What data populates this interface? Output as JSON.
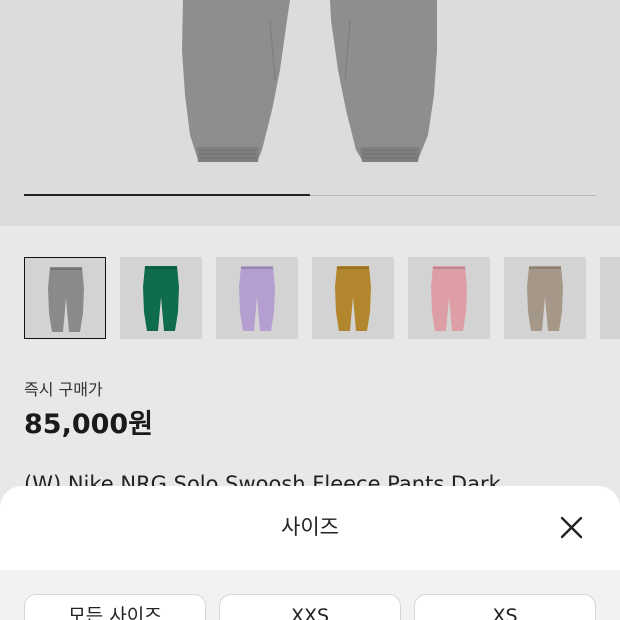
{
  "hero": {
    "product_image": "grey-fleece-pants-image",
    "gallery_progress": 0.5
  },
  "thumbnails": [
    {
      "color": "#8a8a8a",
      "selected": true
    },
    {
      "color": "#0e6b4b",
      "selected": false
    },
    {
      "color": "#b59fd0",
      "selected": false
    },
    {
      "color": "#b2862c",
      "selected": false
    },
    {
      "color": "#de9ea6",
      "selected": false
    },
    {
      "color": "#a59888",
      "selected": false
    },
    {
      "color": "#d0d0d0",
      "selected": false
    }
  ],
  "product": {
    "price_label": "즉시 구매가",
    "price": "85,000원",
    "title": "(W) Nike NRG Solo Swoosh Fleece Pants Dark"
  },
  "size_sheet": {
    "title": "사이즈",
    "close_icon": "close-icon",
    "options": [
      {
        "label": "모든 사이즈"
      },
      {
        "label": "XXS"
      },
      {
        "label": "XS"
      }
    ]
  }
}
